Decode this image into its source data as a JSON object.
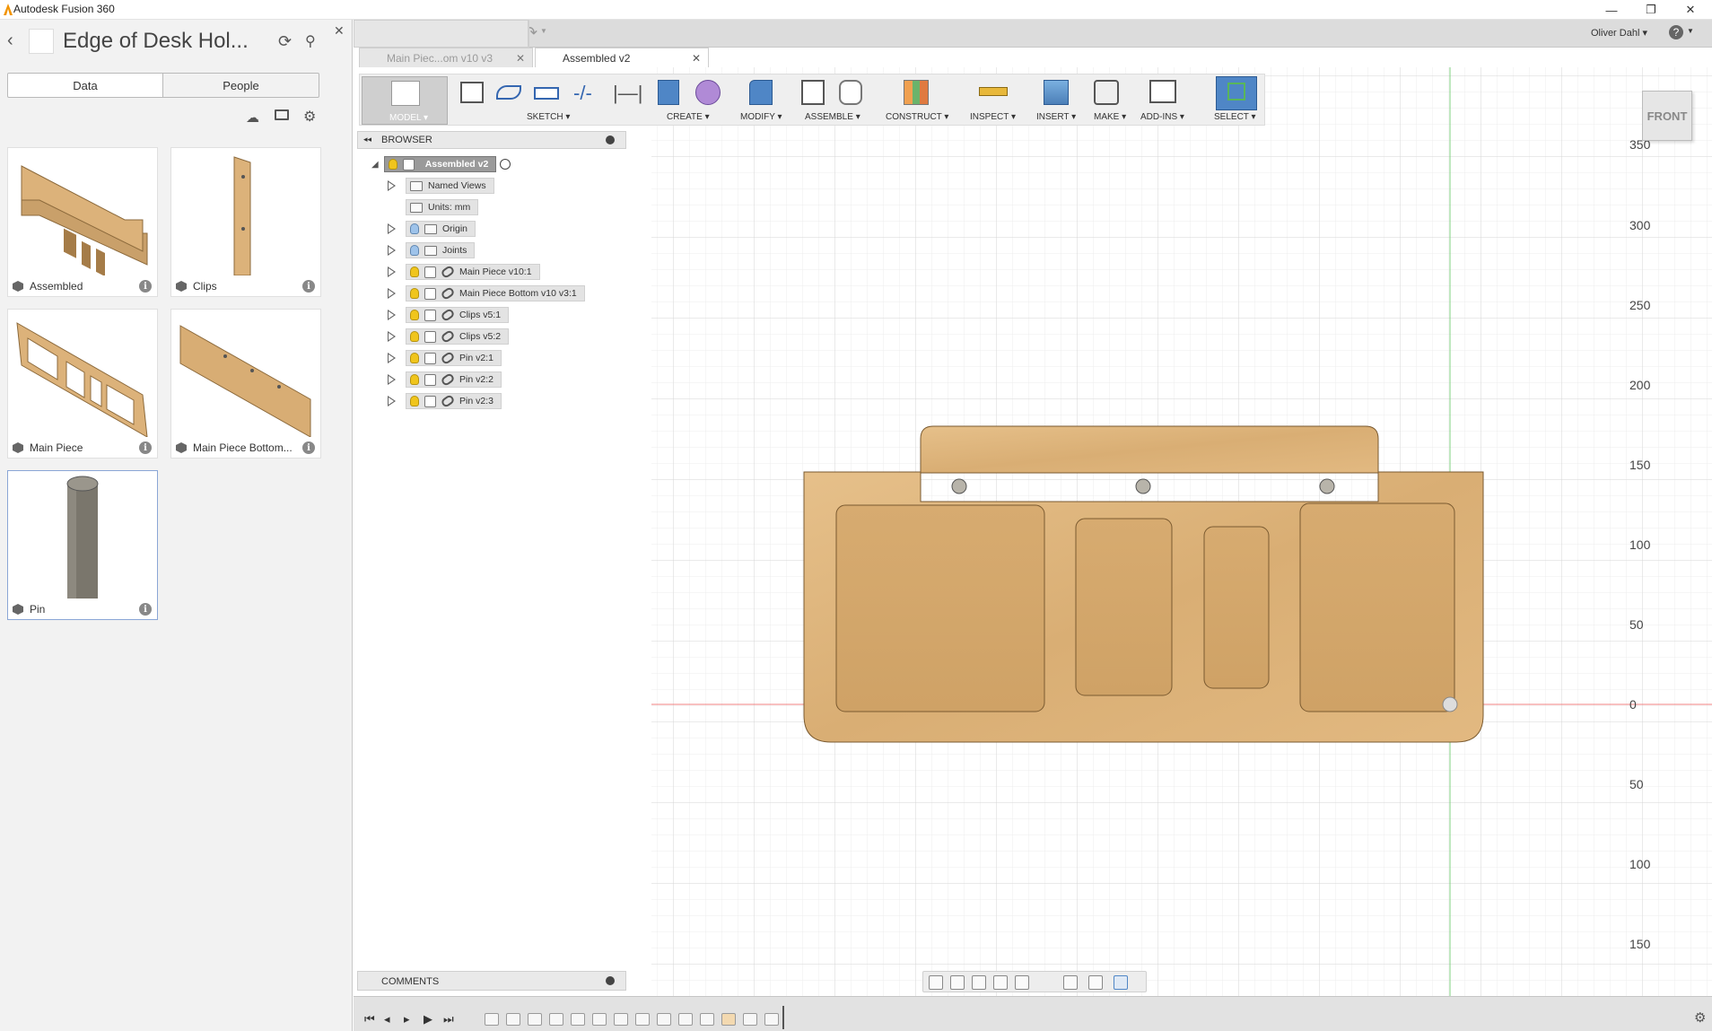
{
  "app": {
    "title": "Autodesk Fusion 360",
    "window_controls": [
      "—",
      "❐",
      "✕"
    ]
  },
  "data_panel": {
    "project_title": "Edge of Desk Hol...",
    "tabs": [
      "Data",
      "People"
    ],
    "cards": [
      {
        "label": "Assembled"
      },
      {
        "label": "Clips"
      },
      {
        "label": "Main Piece"
      },
      {
        "label": "Main Piece Bottom..."
      },
      {
        "label": "Pin"
      }
    ]
  },
  "document_tabs": [
    {
      "label": "Main Piec...om v10 v3",
      "active": false
    },
    {
      "label": "Assembled v2",
      "active": true
    }
  ],
  "user": {
    "name": "Oliver Dahl",
    "help": "?"
  },
  "toolbar": {
    "workspace": "MODEL",
    "groups": [
      "SKETCH",
      "CREATE",
      "MODIFY",
      "ASSEMBLE",
      "CONSTRUCT",
      "INSPECT",
      "INSERT",
      "MAKE",
      "ADD-INS",
      "SELECT"
    ]
  },
  "browser": {
    "header": "BROWSER",
    "root": "Assembled v2",
    "nodes": [
      {
        "label": "Named Views"
      },
      {
        "label": "Units: mm"
      },
      {
        "label": "Origin"
      },
      {
        "label": "Joints"
      },
      {
        "label": "Main Piece v10:1"
      },
      {
        "label": "Main Piece Bottom v10 v3:1"
      },
      {
        "label": "Clips v5:1"
      },
      {
        "label": "Clips v5:2"
      },
      {
        "label": "Pin v2:1"
      },
      {
        "label": "Pin v2:2"
      },
      {
        "label": "Pin v2:3"
      }
    ]
  },
  "comments": {
    "label": "COMMENTS"
  },
  "viewcube": {
    "label": "FRONT"
  },
  "ruler": {
    "ticks": [
      "350",
      "300",
      "250",
      "200",
      "150",
      "100",
      "50",
      "0",
      "50",
      "100",
      "150"
    ]
  },
  "colors": {
    "accent_select": "#4f86c6",
    "bulb": "#f0c51c",
    "wood": "#dcb27a",
    "x_axis": "#f08080",
    "y_axis": "#80d080"
  }
}
